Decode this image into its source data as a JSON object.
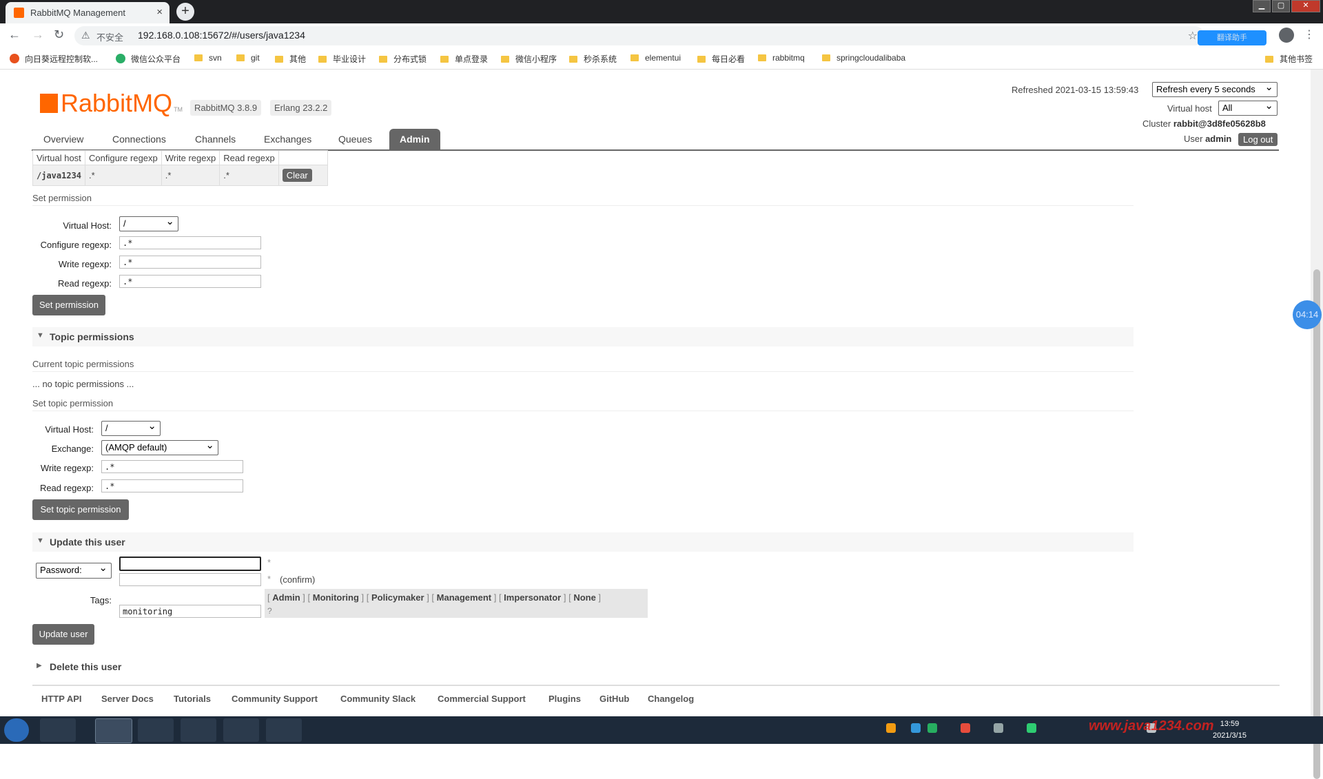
{
  "browser": {
    "tab_title": "RabbitMQ Management",
    "new_tab": "+",
    "close_tab": "×",
    "security_label": "不安全",
    "url": "192.168.0.108:15672/#/users/java1234",
    "extension_label": "翻译助手",
    "bookmarks": [
      "向日葵远程控制软...",
      "微信公众平台",
      "svn",
      "git",
      "其他",
      "毕业设计",
      "分布式锁",
      "单点登录",
      "微信小程序",
      "秒杀系统",
      "elementui",
      "每日必看",
      "rabbitmq",
      "springcloudalibaba",
      "其他书签"
    ]
  },
  "header": {
    "logo_text": "RabbitMQ",
    "tm": "TM",
    "version_badge": "RabbitMQ 3.8.9",
    "erlang_badge": "Erlang 23.2.2",
    "refreshed": "Refreshed 2021-03-15 13:59:43",
    "refresh_select": "Refresh every 5 seconds",
    "vhost_label": "Virtual host",
    "vhost_select": "All",
    "cluster_label": "Cluster",
    "cluster_value": "rabbit@3d8fe05628b8",
    "user_label": "User",
    "user_value": "admin",
    "logout": "Log out"
  },
  "nav": {
    "tabs": [
      "Overview",
      "Connections",
      "Channels",
      "Exchanges",
      "Queues",
      "Admin"
    ],
    "active": "Admin"
  },
  "permissions_table": {
    "headers": [
      "Virtual host",
      "Configure regexp",
      "Write regexp",
      "Read regexp"
    ],
    "rows": [
      {
        "vhost": "/java1234",
        "configure": ".*",
        "write": ".*",
        "read": ".*",
        "action": "Clear"
      }
    ]
  },
  "set_permission": {
    "title": "Set permission",
    "vhost_label": "Virtual Host:",
    "vhost_value": "/",
    "configure_label": "Configure regexp:",
    "configure_value": ".*",
    "write_label": "Write regexp:",
    "write_value": ".*",
    "read_label": "Read regexp:",
    "read_value": ".*",
    "button": "Set permission"
  },
  "topic_permissions": {
    "section_title": "Topic permissions",
    "current_title": "Current topic permissions",
    "empty_text": "... no topic permissions ...",
    "set_title": "Set topic permission",
    "vhost_label": "Virtual Host:",
    "vhost_value": "/",
    "exchange_label": "Exchange:",
    "exchange_value": "(AMQP default)",
    "write_label": "Write regexp:",
    "write_value": ".*",
    "read_label": "Read regexp:",
    "read_value": ".*",
    "button": "Set topic permission"
  },
  "update_user": {
    "section_title": "Update this user",
    "password_select": "Password:",
    "password_value": "",
    "confirm_value": "",
    "asterisk": "*",
    "confirm_label": "(confirm)",
    "tags_label": "Tags:",
    "tags_value": "monitoring",
    "tag_options": [
      "Admin",
      "Monitoring",
      "Policymaker",
      "Management",
      "Impersonator",
      "None"
    ],
    "help": "?",
    "button": "Update user"
  },
  "delete_user": {
    "section_title": "Delete this user"
  },
  "footer": {
    "links": [
      "HTTP API",
      "Server Docs",
      "Tutorials",
      "Community Support",
      "Community Slack",
      "Commercial Support",
      "Plugins",
      "GitHub",
      "Changelog"
    ]
  },
  "overlay": {
    "timer": "04:14"
  },
  "taskbar": {
    "time": "13:59",
    "date": "2021/3/15",
    "watermark": "www.java1234.com"
  }
}
